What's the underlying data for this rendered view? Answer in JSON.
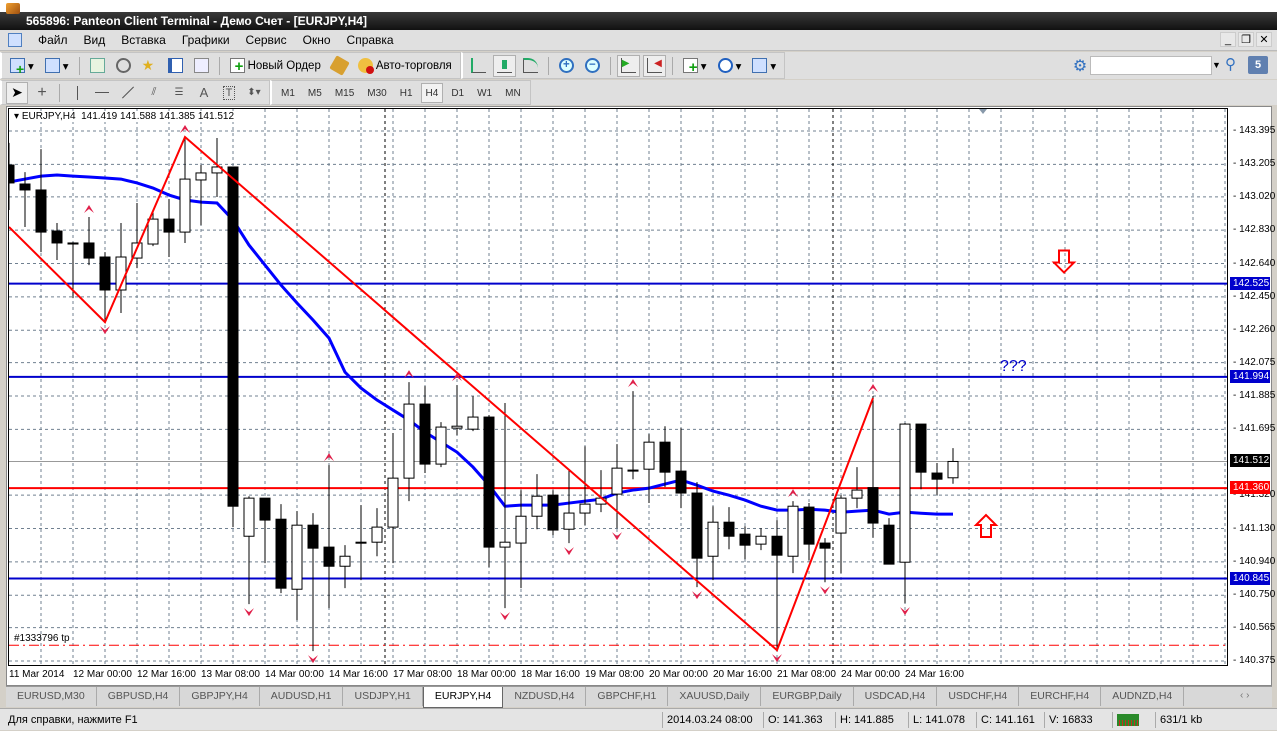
{
  "window": {
    "title": "565896: Panteon Client Terminal - Демо Счет - [EURJPY,H4]"
  },
  "menu": [
    "Файл",
    "Вид",
    "Вставка",
    "Графики",
    "Сервис",
    "Окно",
    "Справка"
  ],
  "toolbar": {
    "new_order": "Новый Ордер",
    "autotrading": "Авто-торговля",
    "search_placeholder": "",
    "notifications": "5"
  },
  "timeframes": [
    "M1",
    "M5",
    "M15",
    "M30",
    "H1",
    "H4",
    "D1",
    "W1",
    "MN"
  ],
  "active_timeframe": "H4",
  "drawing_tools": {
    "text_tool": "A"
  },
  "chart_header": "EURJPY,H4  141.419 141.588 141.385 141.512",
  "chart_data": {
    "type": "candlestick",
    "symbol": "EURJPY",
    "timeframe": "H4",
    "ylim": [
      140.375,
      143.395
    ],
    "y_ticks": [
      "143.395",
      "143.205",
      "143.020",
      "142.830",
      "142.640",
      "142.450",
      "142.260",
      "142.075",
      "141.885",
      "141.695",
      "141.320",
      "141.130",
      "140.940",
      "140.750",
      "140.565",
      "140.375"
    ],
    "x_ticks": [
      "11 Mar 2014",
      "12 Mar 00:00",
      "12 Mar 16:00",
      "13 Mar 08:00",
      "14 Mar 00:00",
      "14 Mar 16:00",
      "17 Mar 08:00",
      "18 Mar 00:00",
      "18 Mar 16:00",
      "19 Mar 08:00",
      "20 Mar 00:00",
      "20 Mar 16:00",
      "21 Mar 08:00",
      "24 Mar 00:00",
      "24 Mar 16:00"
    ],
    "ohlc": [
      [
        143.201,
        143.327,
        142.945,
        143.099
      ],
      [
        143.093,
        143.161,
        142.848,
        143.059
      ],
      [
        143.059,
        143.292,
        142.705,
        142.819
      ],
      [
        142.825,
        142.871,
        142.66,
        142.757
      ],
      [
        142.757,
        142.762,
        142.443,
        142.751
      ],
      [
        142.757,
        142.905,
        142.631,
        142.671
      ],
      [
        142.677,
        142.705,
        142.306,
        142.489
      ],
      [
        142.489,
        142.871,
        142.358,
        142.677
      ],
      [
        142.671,
        142.985,
        142.614,
        142.757
      ],
      [
        142.751,
        142.945,
        142.739,
        142.893
      ],
      [
        142.893,
        143.007,
        142.677,
        142.819
      ],
      [
        142.819,
        143.361,
        142.757,
        143.121
      ],
      [
        143.116,
        143.201,
        142.859,
        143.156
      ],
      [
        143.156,
        143.355,
        143.019,
        143.19
      ],
      [
        143.19,
        143.19,
        141.138,
        141.257
      ],
      [
        141.086,
        141.314,
        140.699,
        141.303
      ],
      [
        141.303,
        141.303,
        140.933,
        141.178
      ],
      [
        141.183,
        141.269,
        140.762,
        140.79
      ],
      [
        140.784,
        141.229,
        140.608,
        141.149
      ],
      [
        141.149,
        141.218,
        140.431,
        141.018
      ],
      [
        141.024,
        141.491,
        140.676,
        140.915
      ],
      [
        140.915,
        141.035,
        140.79,
        140.972
      ],
      [
        141.047,
        141.263,
        140.836,
        141.052
      ],
      [
        141.052,
        141.246,
        140.972,
        141.138
      ],
      [
        141.138,
        141.674,
        140.933,
        141.417
      ],
      [
        141.417,
        141.964,
        141.286,
        141.839
      ],
      [
        141.839,
        141.941,
        141.446,
        141.497
      ],
      [
        141.497,
        141.736,
        141.48,
        141.708
      ],
      [
        141.702,
        141.947,
        141.662,
        141.713
      ],
      [
        141.696,
        141.884,
        141.685,
        141.765
      ],
      [
        141.765,
        141.776,
        140.91,
        141.024
      ],
      [
        141.024,
        141.845,
        140.676,
        141.052
      ],
      [
        141.047,
        141.349,
        140.79,
        141.2
      ],
      [
        141.2,
        141.44,
        141.126,
        141.314
      ],
      [
        141.32,
        141.349,
        141.092,
        141.121
      ],
      [
        141.126,
        141.463,
        141.047,
        141.218
      ],
      [
        141.218,
        141.599,
        141.149,
        141.269
      ],
      [
        141.269,
        141.463,
        141.223,
        141.303
      ],
      [
        141.326,
        141.611,
        141.132,
        141.474
      ],
      [
        141.463,
        141.913,
        141.411,
        141.457
      ],
      [
        141.468,
        141.668,
        141.275,
        141.622
      ],
      [
        141.622,
        141.713,
        141.366,
        141.451
      ],
      [
        141.457,
        141.702,
        141.246,
        141.332
      ],
      [
        141.332,
        141.394,
        140.796,
        140.961
      ],
      [
        140.972,
        141.257,
        140.836,
        141.166
      ],
      [
        141.166,
        141.252,
        141.012,
        141.086
      ],
      [
        141.098,
        141.143,
        140.955,
        141.035
      ],
      [
        141.041,
        141.132,
        141.007,
        141.086
      ],
      [
        141.086,
        141.178,
        140.437,
        140.978
      ],
      [
        140.972,
        141.286,
        140.876,
        141.257
      ],
      [
        141.252,
        141.275,
        140.95,
        141.041
      ],
      [
        141.047,
        141.075,
        140.824,
        141.018
      ],
      [
        141.104,
        141.32,
        140.876,
        141.303
      ],
      [
        141.303,
        141.48,
        141.246,
        141.349
      ],
      [
        141.363,
        141.885,
        141.078,
        141.161
      ],
      [
        141.149,
        141.189,
        140.927,
        140.927
      ],
      [
        140.938,
        141.731,
        140.705,
        141.725
      ],
      [
        141.725,
        141.725,
        141.354,
        141.451
      ],
      [
        141.446,
        141.503,
        141.32,
        141.411
      ],
      [
        141.419,
        141.588,
        141.385,
        141.512
      ]
    ],
    "moving_average": [
      143.104,
      143.121,
      143.138,
      143.144,
      143.138,
      143.133,
      143.127,
      143.121,
      143.099,
      143.07,
      143.03,
      143.002,
      142.99,
      142.985,
      142.888,
      142.745,
      142.631,
      142.517,
      142.415,
      142.318,
      142.215,
      142.021,
      141.93,
      141.862,
      141.805,
      141.748,
      141.679,
      141.622,
      141.565,
      141.48,
      141.377,
      141.257,
      141.263,
      141.263,
      141.263,
      141.275,
      141.286,
      141.297,
      141.332,
      141.349,
      141.36,
      141.383,
      141.406,
      141.377,
      141.343,
      141.32,
      141.292,
      141.257,
      141.235,
      141.235,
      141.24,
      141.235,
      141.223,
      141.229,
      141.235,
      141.212,
      141.223,
      141.217,
      141.212,
      141.212
    ],
    "zigzag": [
      [
        0,
        142.848
      ],
      [
        6,
        142.306
      ],
      [
        11,
        143.361
      ],
      [
        48,
        140.437
      ],
      [
        54,
        141.873
      ]
    ],
    "fractals_up": [
      5,
      11,
      20,
      25,
      28,
      39,
      49,
      54
    ],
    "fractals_down": [
      6,
      15,
      19,
      31,
      35,
      38,
      43,
      48,
      51,
      56
    ],
    "period_separators": [
      24,
      52
    ],
    "hlines": [
      {
        "price": 142.525,
        "label": "142.525",
        "color": "#0000cc"
      },
      {
        "price": 141.994,
        "label": "141.994",
        "color": "#0000cc"
      },
      {
        "price": 140.845,
        "label": "140.845",
        "color": "#0000cc"
      },
      {
        "price": 141.36,
        "label": "141.360",
        "color": "#ff0000"
      }
    ],
    "bid": {
      "price": 141.512,
      "label": "141.512"
    },
    "tp_line": {
      "price": 140.465,
      "label": "#1333796 tp"
    },
    "annotation": "???",
    "arrow_down_price": 142.6,
    "arrow_up_price": 141.15
  },
  "tabs": [
    "EURUSD,M30",
    "GBPUSD,H4",
    "GBPJPY,H4",
    "AUDUSD,H1",
    "USDJPY,H1",
    "EURJPY,H4",
    "NZDUSD,H4",
    "GBPCHF,H1",
    "XAUUSD,Daily",
    "EURGBP,Daily",
    "USDCAD,H4",
    "USDCHF,H4",
    "EURCHF,H4",
    "AUDNZD,H4"
  ],
  "active_tab": "EURJPY,H4",
  "status": {
    "help": "Для справки, нажмите F1",
    "datetime": "2014.03.24 08:00",
    "open": "O: 141.363",
    "high": "H: 141.885",
    "low": "L: 141.078",
    "close": "C: 141.161",
    "volume": "V: 16833",
    "traffic": "631/1 kb"
  },
  "colors": {
    "bull": "#ffffff",
    "bear": "#000000",
    "ma": "#0000ff",
    "zigzag": "#ff0000",
    "fractal": "#e0204a",
    "grid": "#708090"
  }
}
